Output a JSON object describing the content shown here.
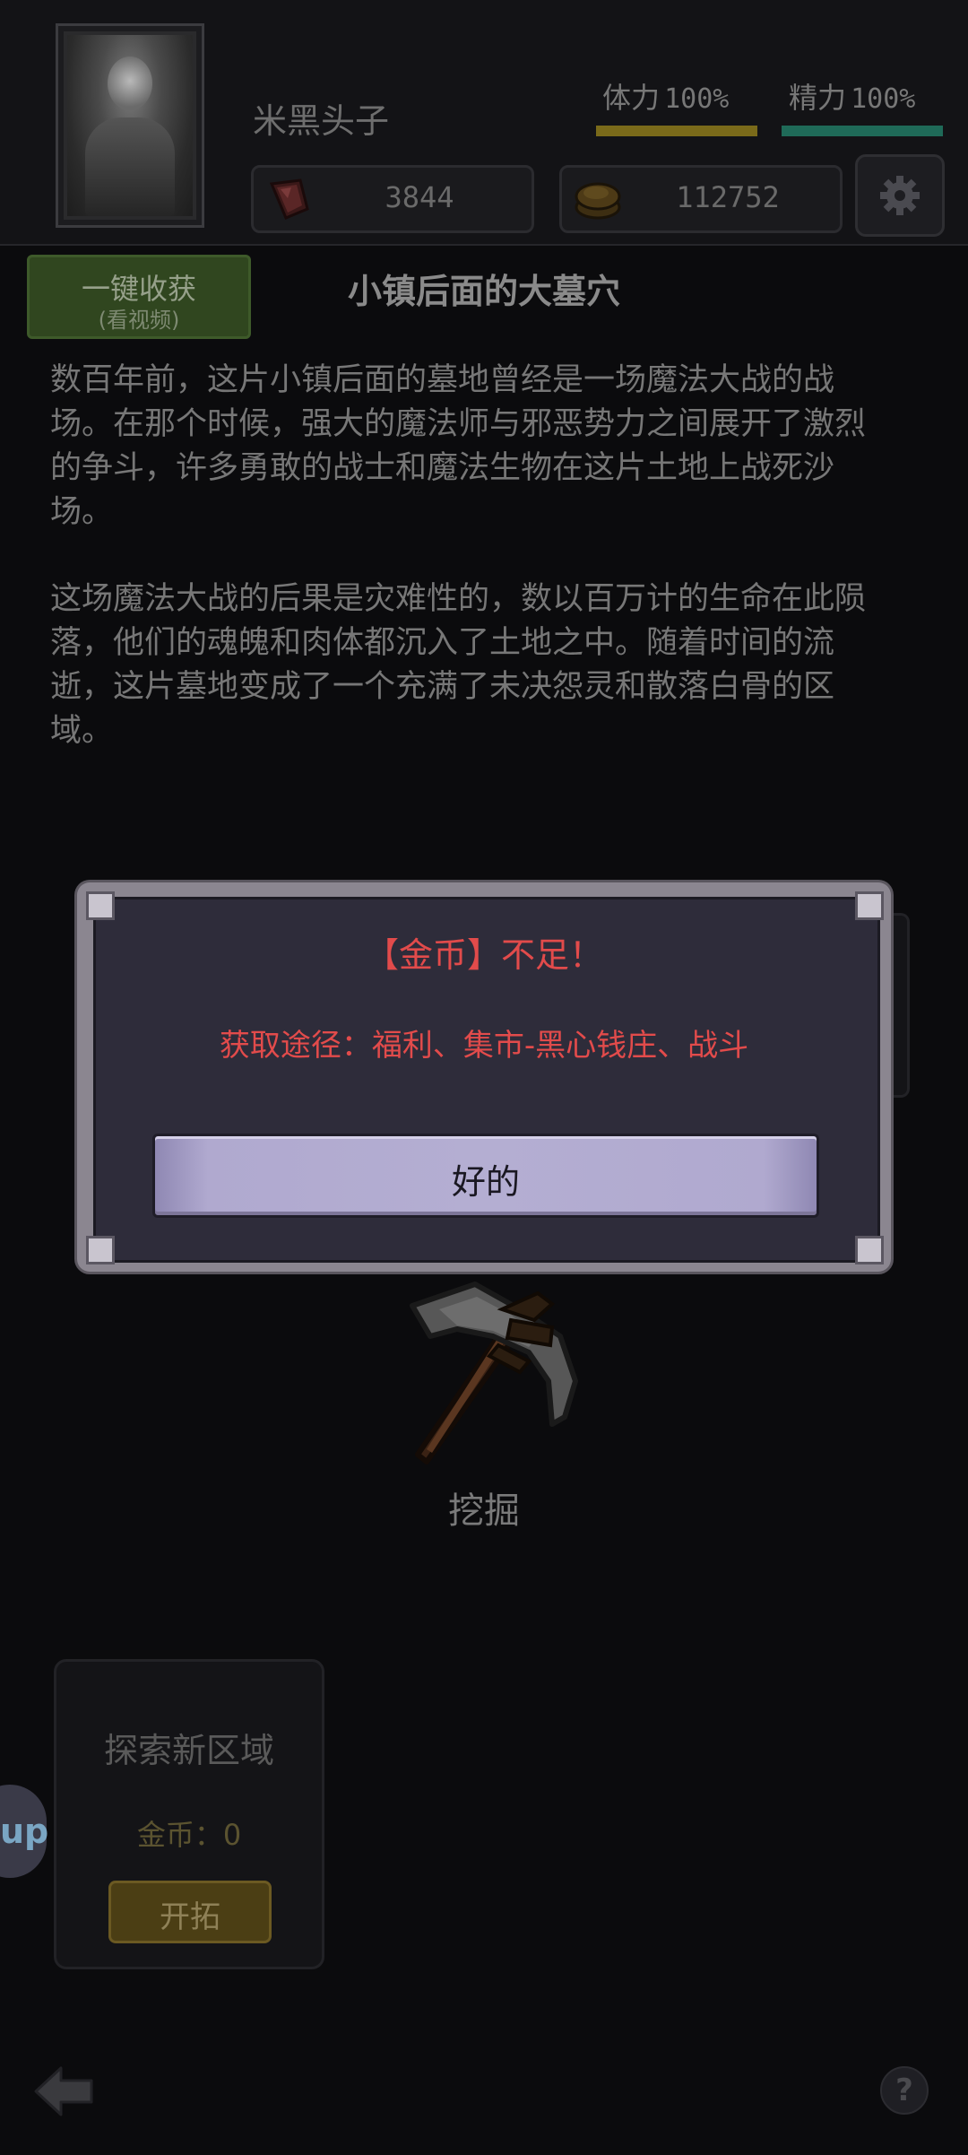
{
  "player": {
    "name": "米黑头子"
  },
  "stats": {
    "stamina": {
      "label": "体力",
      "value": "100%",
      "color": "#7a6a1a"
    },
    "energy": {
      "label": "精力",
      "value": "100%",
      "color": "#1f6a58"
    }
  },
  "resources": {
    "gems": "3844",
    "gold": "112752"
  },
  "harvest_button": {
    "line1": "一键收获",
    "line2": "(看视频)"
  },
  "area": {
    "title": "小镇后面的大墓穴",
    "paragraph1": "数百年前，这片小镇后面的墓地曾经是一场魔法大战的战场。在那个时候，强大的魔法师与邪恶势力之间展开了激烈的争斗，许多勇敢的战士和魔法生物在这片土地上战死沙场。",
    "paragraph2": "这场魔法大战的后果是灾难性的，数以百万计的生命在此陨落，他们的魂魄和肉体都沉入了土地之中。随着时间的流逝，这片墓地变成了一个充满了未决怨灵和散落白骨的区域。"
  },
  "dig": {
    "label": "挖掘"
  },
  "explore": {
    "title": "探索新区域",
    "cost": "金币：0",
    "button": "开拓"
  },
  "side_tab": {
    "label": "up"
  },
  "help": {
    "label": "?"
  },
  "modal": {
    "title": "【金币】不足！",
    "description": "获取途径：福利、集市-黑心钱庄、战斗",
    "ok_button": "好的",
    "accent_color": "#e24b4b"
  }
}
